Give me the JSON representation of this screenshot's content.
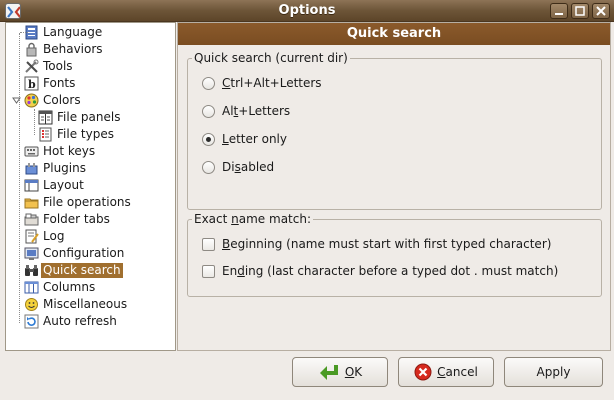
{
  "window": {
    "title": "Options"
  },
  "tree": {
    "items": [
      {
        "label": "Language",
        "icon": "language-icon"
      },
      {
        "label": "Behaviors",
        "icon": "lock-icon"
      },
      {
        "label": "Tools",
        "icon": "tools-icon"
      },
      {
        "label": "Fonts",
        "icon": "font-icon"
      },
      {
        "label": "Colors",
        "icon": "palette-icon",
        "expanded": true
      },
      {
        "label": "File panels",
        "icon": "file-panels-icon",
        "child": true
      },
      {
        "label": "File types",
        "icon": "file-types-icon",
        "child": true
      },
      {
        "label": "Hot keys",
        "icon": "keyboard-icon"
      },
      {
        "label": "Plugins",
        "icon": "plugin-icon"
      },
      {
        "label": "Layout",
        "icon": "layout-icon"
      },
      {
        "label": "File operations",
        "icon": "file-operations-icon"
      },
      {
        "label": "Folder tabs",
        "icon": "folder-tabs-icon"
      },
      {
        "label": "Log",
        "icon": "log-icon"
      },
      {
        "label": "Configuration",
        "icon": "configuration-icon"
      },
      {
        "label": "Quick search",
        "icon": "binoculars-icon",
        "selected": true
      },
      {
        "label": "Columns",
        "icon": "columns-icon"
      },
      {
        "label": "Miscellaneous",
        "icon": "miscellaneous-icon"
      },
      {
        "label": "Auto refresh",
        "icon": "refresh-icon"
      }
    ]
  },
  "panel": {
    "header": "Quick search",
    "quick_search_group": {
      "legend": "Quick search (current dir)",
      "options": [
        {
          "pre": "",
          "mnemonic": "C",
          "post": "trl+Alt+Letters",
          "checked": false
        },
        {
          "pre": "Al",
          "mnemonic": "t",
          "post": "+Letters",
          "checked": false
        },
        {
          "pre": "",
          "mnemonic": "L",
          "post": "etter only",
          "checked": true
        },
        {
          "pre": "Di",
          "mnemonic": "s",
          "post": "abled",
          "checked": false
        }
      ]
    },
    "exact_match_group": {
      "legend_pre": "Exact ",
      "legend_mnemonic": "n",
      "legend_post": "ame match:",
      "options": [
        {
          "pre": "",
          "mnemonic": "B",
          "post": "eginning (name must start with first typed character)",
          "checked": false
        },
        {
          "pre": "En",
          "mnemonic": "d",
          "post": "ing (last character before a typed dot . must match)",
          "checked": false
        }
      ]
    }
  },
  "buttons": {
    "ok": {
      "pre": "",
      "mnemonic": "O",
      "post": "K"
    },
    "cancel": {
      "pre": "",
      "mnemonic": "C",
      "post": "ancel"
    },
    "apply": {
      "label": "Apply"
    }
  },
  "colors": {
    "title_bar": "#6d5538",
    "panel_header": "#7a4d22",
    "selection": "#a06f2f"
  }
}
